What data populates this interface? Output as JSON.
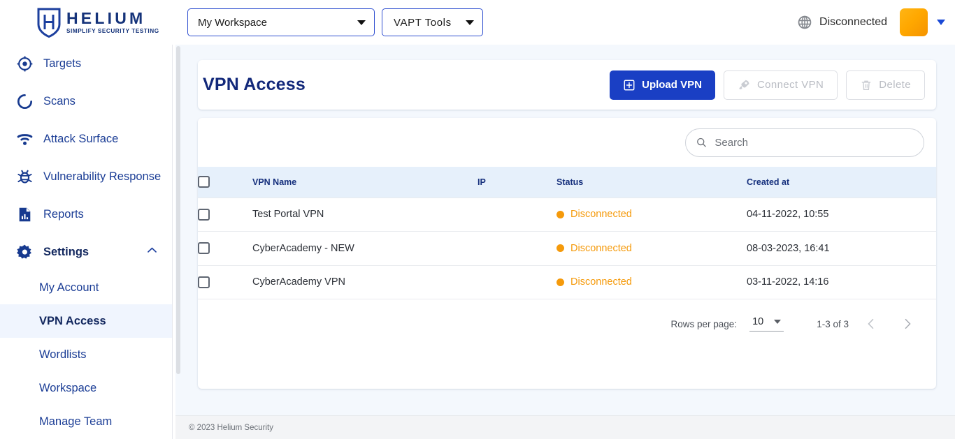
{
  "header": {
    "logo": {
      "name": "HELIUM",
      "tagline": "SIMPLIFY SECURITY TESTING",
      "icon": "shield-h-logo",
      "color": "#15337a"
    },
    "workspace_select": {
      "value": "My Workspace",
      "icon": "chevron-down-icon"
    },
    "tools_select": {
      "value": "VAPT Tools",
      "icon": "chevron-down-icon"
    },
    "connection": {
      "status": "Disconnected",
      "icon": "globe-icon"
    },
    "avatar": {
      "icon": "user-avatar",
      "color": "#ffa800"
    },
    "avatar_caret": {
      "icon": "caret-down-icon",
      "color": "#1a49d6"
    }
  },
  "sidebar": {
    "items": [
      {
        "label": "Targets",
        "icon": "target-icon"
      },
      {
        "label": "Scans",
        "icon": "scan-spinner-icon"
      },
      {
        "label": "Attack Surface",
        "icon": "radar-wifi-icon"
      },
      {
        "label": "Vulnerability Response",
        "icon": "bug-icon"
      },
      {
        "label": "Reports",
        "icon": "report-document-icon"
      },
      {
        "label": "Settings",
        "icon": "gear-icon",
        "expanded": true,
        "chevron": "chevron-up-icon"
      }
    ],
    "settings_children": [
      {
        "label": "My Account",
        "active": false
      },
      {
        "label": "VPN Access",
        "active": true
      },
      {
        "label": "Wordlists",
        "active": false
      },
      {
        "label": "Workspace",
        "active": false
      },
      {
        "label": "Manage Team",
        "active": false
      }
    ]
  },
  "page": {
    "title": "VPN Access",
    "actions": {
      "upload": {
        "label": "Upload VPN",
        "icon": "plus-square-icon",
        "disabled": false,
        "color": "#1a3fc4"
      },
      "connect": {
        "label": "Connect VPN",
        "icon": "rocket-icon",
        "disabled": true
      },
      "delete": {
        "label": "Delete",
        "icon": "trash-icon",
        "disabled": true
      }
    },
    "search": {
      "value": "",
      "placeholder": "Search",
      "icon": "search-icon"
    },
    "table": {
      "columns": [
        "VPN Name",
        "IP",
        "Status",
        "Created at"
      ],
      "select_all_checkbox": "unchecked",
      "rows": [
        {
          "checked": false,
          "name": "Test Portal VPN",
          "ip": "",
          "status": "Disconnected",
          "status_color": "#f59a0b",
          "created_at": "04-11-2022, 10:55"
        },
        {
          "checked": false,
          "name": "CyberAcademy - NEW",
          "ip": "",
          "status": "Disconnected",
          "status_color": "#f59a0b",
          "created_at": "08-03-2023, 16:41"
        },
        {
          "checked": false,
          "name": "CyberAcademy VPN",
          "ip": "",
          "status": "Disconnected",
          "status_color": "#f59a0b",
          "created_at": "03-11-2022, 14:16"
        }
      ]
    },
    "pagination": {
      "rows_per_page_label": "Rows per page:",
      "rows_per_page_value": "10",
      "range": "1-3 of 3",
      "prev_icon": "chevron-left-icon",
      "next_icon": "chevron-right-icon"
    }
  },
  "footer": {
    "copyright": "© 2023 Helium Security"
  }
}
